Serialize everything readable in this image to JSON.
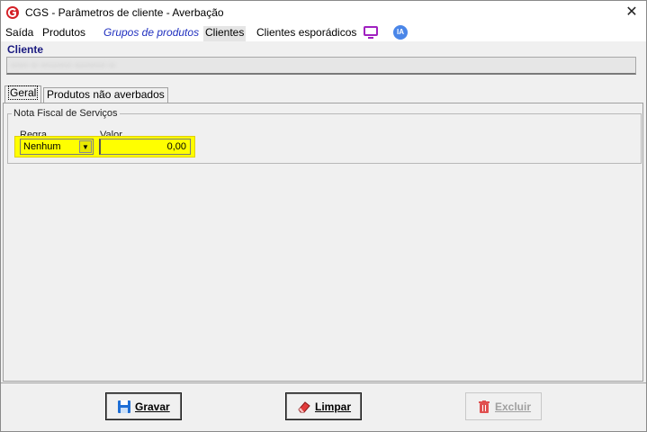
{
  "window": {
    "title": "CGS - Parâmetros de cliente - Averbação",
    "close_glyph": "✕"
  },
  "menu": {
    "items": [
      "Saída",
      "Produtos",
      "Grupos de produtos",
      "Clientes",
      "Clientes esporádicos"
    ],
    "ia_label": "IA",
    "accent_color": "#1f2fbf"
  },
  "cliente": {
    "label": "Cliente",
    "value": "••••• •• ••••••••• ••••••••• ••"
  },
  "tabs": [
    "Geral",
    "Produtos não averbados"
  ],
  "nota_fiscal": {
    "title": "Nota Fiscal de Serviços",
    "regra_label": "Regra",
    "regra_value": "Nenhum",
    "valor_label": "Valor",
    "valor_value": "0,00",
    "highlight_color": "#ffff00"
  },
  "buttons": {
    "gravar": "Gravar",
    "limpar": "Limpar",
    "excluir": "Excluir"
  },
  "icons": [
    "app-logo-icon",
    "close-icon",
    "monitor-icon",
    "ia-icon",
    "dropdown-arrow-icon",
    "save-icon",
    "eraser-icon",
    "trash-icon"
  ]
}
